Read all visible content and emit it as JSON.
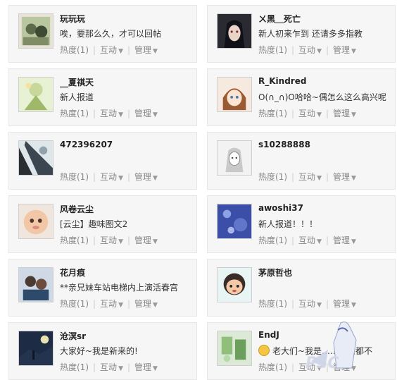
{
  "common": {
    "heat": "热度(1)",
    "interact": "互动",
    "manage": "管理"
  },
  "left": [
    {
      "name": "玩玩玩",
      "status": "唉，要那么久，才可以回帖"
    },
    {
      "name": "__夏祺天",
      "status": "新人报道"
    },
    {
      "name": "472396207",
      "status": ""
    },
    {
      "name": "风卷云尘",
      "status": "[云尘】趣味图文2"
    },
    {
      "name": "花月痕",
      "status": "**亲兄妹车站电梯内上演活春宫"
    },
    {
      "name": "沧溟sr",
      "status": "大家好~我是新来的!"
    }
  ],
  "right": [
    {
      "name": "ㄨ黑＿死亡",
      "status": "新人初来乍到  还请多多指教"
    },
    {
      "name": "R_Kindred",
      "status": "O(∩_∩)O哈哈~偶怎么这么高兴呢"
    },
    {
      "name": "s10288888",
      "status": ""
    },
    {
      "name": "awoshi37",
      "status": "新人报道！！！"
    },
    {
      "name": "茅原哲也",
      "status": ""
    },
    {
      "name": "EndJ",
      "status": "老大们~我是……什么都不"
    }
  ],
  "colors": {
    "card_bg": "#f6f6f6",
    "action_text": "#888888"
  },
  "icons": {
    "dropdown": "caret-down-icon"
  }
}
